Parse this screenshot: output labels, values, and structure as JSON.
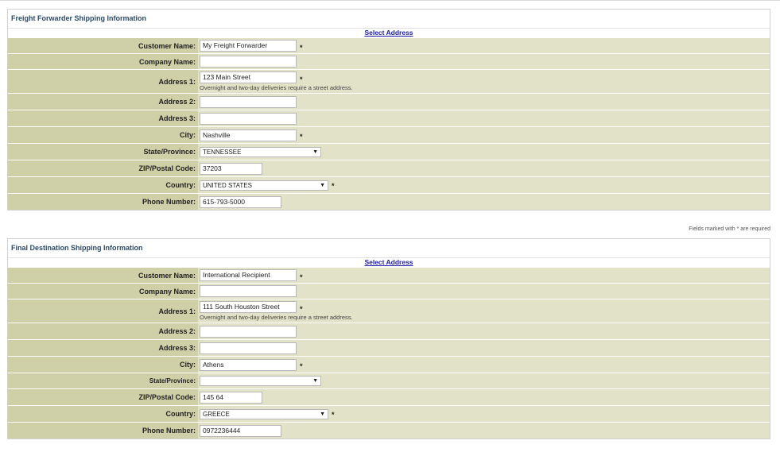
{
  "notes": {
    "required": "Fields marked with * are required",
    "street": "Overnight and two-day deliveries require a street address."
  },
  "forwarder": {
    "title": "Freight Forwarder Shipping Information",
    "select_address": "Select Address",
    "labels": {
      "customer_name": "Customer Name:",
      "company_name": "Company Name:",
      "address1": "Address 1:",
      "address2": "Address 2:",
      "address3": "Address 3:",
      "city": "City:",
      "state": "State/Province:",
      "zip": "ZIP/Postal Code:",
      "country": "Country:",
      "phone": "Phone Number:"
    },
    "values": {
      "customer_name": "My Freight Forwarder",
      "company_name": "",
      "address1": "123 Main Street",
      "address2": "",
      "address3": "",
      "city": "Nashville",
      "state": "TENNESSEE",
      "zip": "37203",
      "country": "UNITED STATES",
      "phone": "615-793-5000"
    }
  },
  "destination": {
    "title": "Final Destination Shipping Information",
    "select_address": "Select Address",
    "labels": {
      "customer_name": "Customer Name:",
      "company_name": "Company Name:",
      "address1": "Address 1:",
      "address2": "Address 2:",
      "address3": "Address 3:",
      "city": "City:",
      "state": "State/Province:",
      "zip": "ZIP/Postal Code:",
      "country": "Country:",
      "phone": "Phone Number:"
    },
    "values": {
      "customer_name": "International Recipient",
      "company_name": "",
      "address1": "111 South Houston Street",
      "address2": "",
      "address3": "",
      "city": "Athens",
      "state": "",
      "zip": "145 64",
      "country": "GREECE",
      "phone": "0972236444"
    }
  },
  "required_marker": "*",
  "dropdown_arrow": "▼"
}
